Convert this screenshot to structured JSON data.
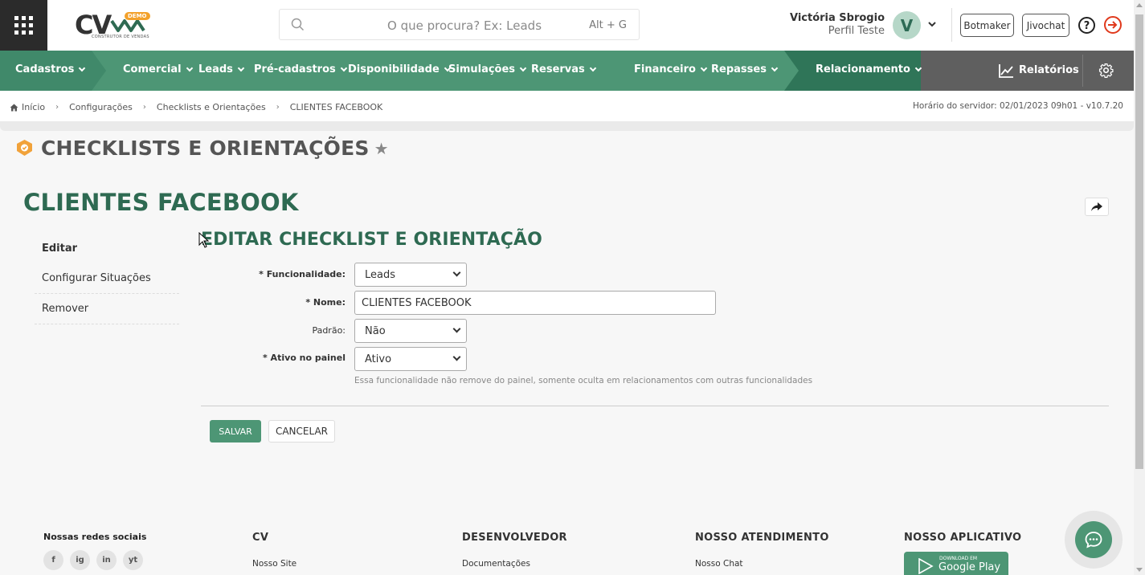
{
  "header": {
    "logo_text": "CV",
    "logo_badge": "DEMO",
    "logo_subtitle": "CONSTRUTOR DE VENDAS",
    "search_placeholder": "O que procura? Ex: Leads",
    "search_shortcut": "Alt + G",
    "user_name": "Victória Sbrogio",
    "user_profile": "Perfil Teste",
    "avatar_initial": "V",
    "botmaker_label": "Botmaker",
    "jivochat_label": "Jivochat"
  },
  "nav": {
    "items": [
      {
        "label": "Cadastros"
      },
      {
        "label": "Comercial"
      },
      {
        "label": "Leads"
      },
      {
        "label": "Pré-cadastros"
      },
      {
        "label": "Disponibilidade"
      },
      {
        "label": "Simulações"
      },
      {
        "label": "Reservas"
      },
      {
        "label": "Financeiro"
      },
      {
        "label": "Repasses"
      },
      {
        "label": "Relacionamento"
      }
    ],
    "reports_label": "Relatórios"
  },
  "breadcrumb": {
    "items": [
      "Início",
      "Configurações",
      "Checklists e Orientações",
      "CLIENTES FACEBOOK"
    ],
    "server_time": "Horário do servidor: 02/01/2023 09h01 - v10.7.20"
  },
  "page": {
    "title": "CHECKLISTS E ORIENTAÇÕES",
    "record_title": "CLIENTES FACEBOOK"
  },
  "side_menu": {
    "items": [
      "Editar",
      "Configurar Situações",
      "Remover"
    ]
  },
  "form": {
    "title": "EDITAR CHECKLIST E ORIENTAÇÃO",
    "funcionalidade_label": "* Funcionalidade:",
    "funcionalidade_value": "Leads",
    "nome_label": "* Nome:",
    "nome_value": "CLIENTES FACEBOOK",
    "padrao_label": "Padrão:",
    "padrao_value": "Não",
    "ativo_label": "* Ativo no painel",
    "ativo_value": "Ativo",
    "ativo_hint": "Essa funcionalidade não remove do painel, somente oculta em relacionamentos com outras funcionalidades",
    "save_label": "SALVAR",
    "cancel_label": "CANCELAR"
  },
  "footer": {
    "social_title": "Nossas redes sociais",
    "social_icons": [
      "f",
      "ig",
      "in",
      "yt"
    ],
    "cv_title": "CV",
    "cv_link": "Nosso Site",
    "dev_title": "DESENVOLVEDOR",
    "dev_link": "Documentações",
    "support_title": "NOSSO ATENDIMENTO",
    "support_link": "Nosso Chat",
    "app_title": "NOSSO APLICATIVO",
    "gplay_small": "DOWNLOAD EM",
    "gplay_big": "Google Play"
  },
  "colors": {
    "brand_green": "#4d9675",
    "dark_green": "#2e6a52",
    "exit_red": "#e0391c"
  }
}
